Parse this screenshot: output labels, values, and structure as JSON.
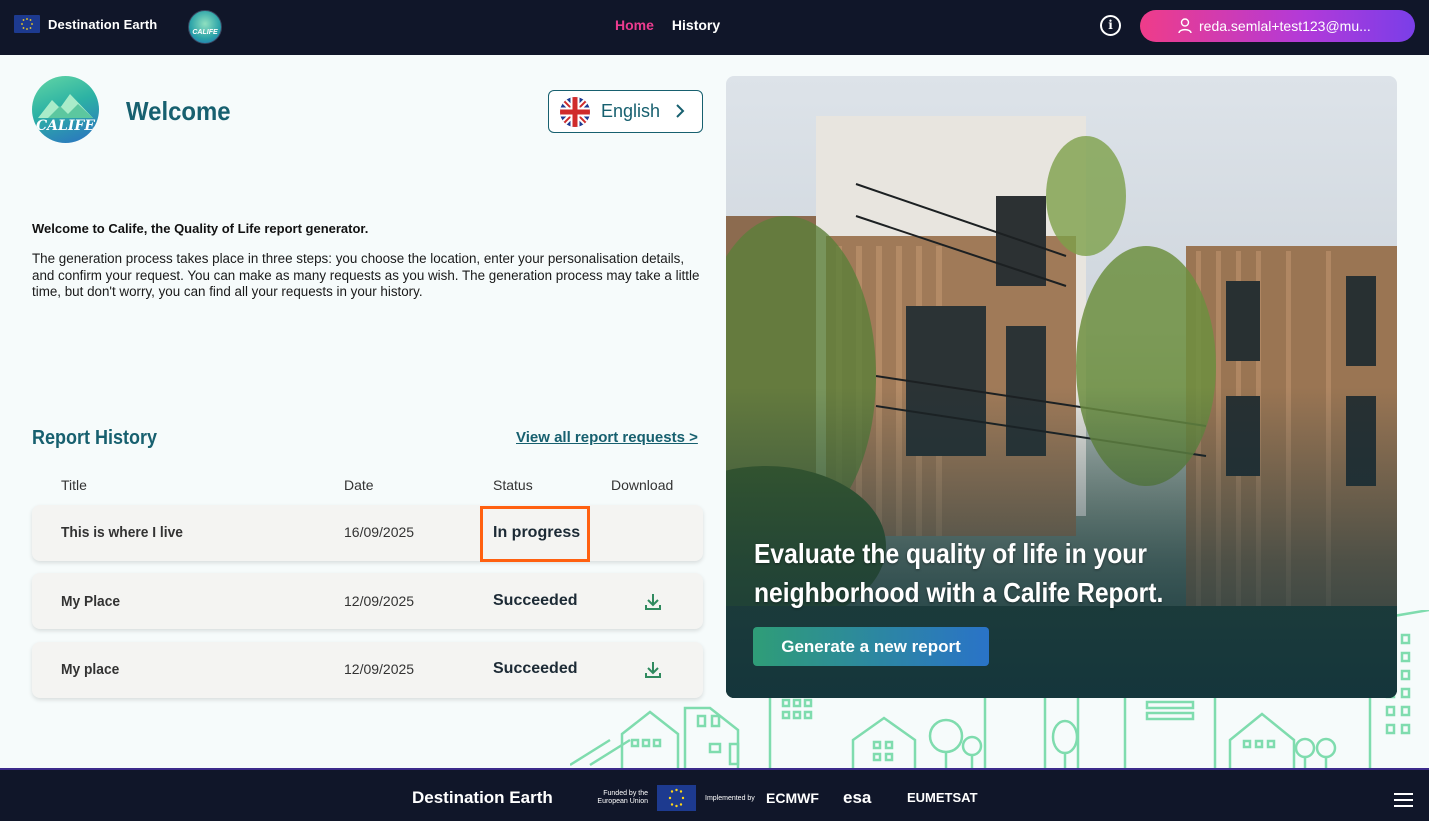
{
  "header": {
    "brand": "Destination Earth",
    "app_logo_text": "CALIFE",
    "nav": [
      {
        "label": "Home",
        "active": true
      },
      {
        "label": "History",
        "active": false
      }
    ],
    "info_icon": "info-icon",
    "user_label": "reda.semlal+test123@mu...",
    "accent": "#ec3c8f"
  },
  "welcome": {
    "logo_text": "CALIFE",
    "title": "Welcome",
    "language": "English",
    "intro_bold": "Welcome to Calife, the Quality of Life report generator.",
    "intro_text": "The generation process takes place in three steps: you choose the location, enter your personalisation details, and confirm your request. You can make as many requests as you wish. The generation process may take a little time, but don't worry, you can find all your requests in your history."
  },
  "report_history": {
    "title": "Report History",
    "view_all": "View all report requests >",
    "columns": [
      "Title",
      "Date",
      "Status",
      "Download"
    ],
    "rows": [
      {
        "title": "This is where I live",
        "date": "16/09/2025",
        "status": "In progress",
        "downloadable": false
      },
      {
        "title": "My Place",
        "date": "12/09/2025",
        "status": "Succeeded",
        "downloadable": true
      },
      {
        "title": "My place",
        "date": "12/09/2025",
        "status": "Succeeded",
        "downloadable": true
      }
    ]
  },
  "hero": {
    "headline": "Evaluate the quality of life in your neighborhood with a Calife Report.",
    "button": "Generate a new report"
  },
  "footer": {
    "brand": "Destination Earth",
    "funded": "Funded by the European Union",
    "implemented": "Implemented by",
    "partners": [
      "ECMWF",
      "esa",
      "EUMETSAT"
    ]
  },
  "colors": {
    "navy": "#101629",
    "teal": "#17606f",
    "highlight": "#ff6010"
  }
}
